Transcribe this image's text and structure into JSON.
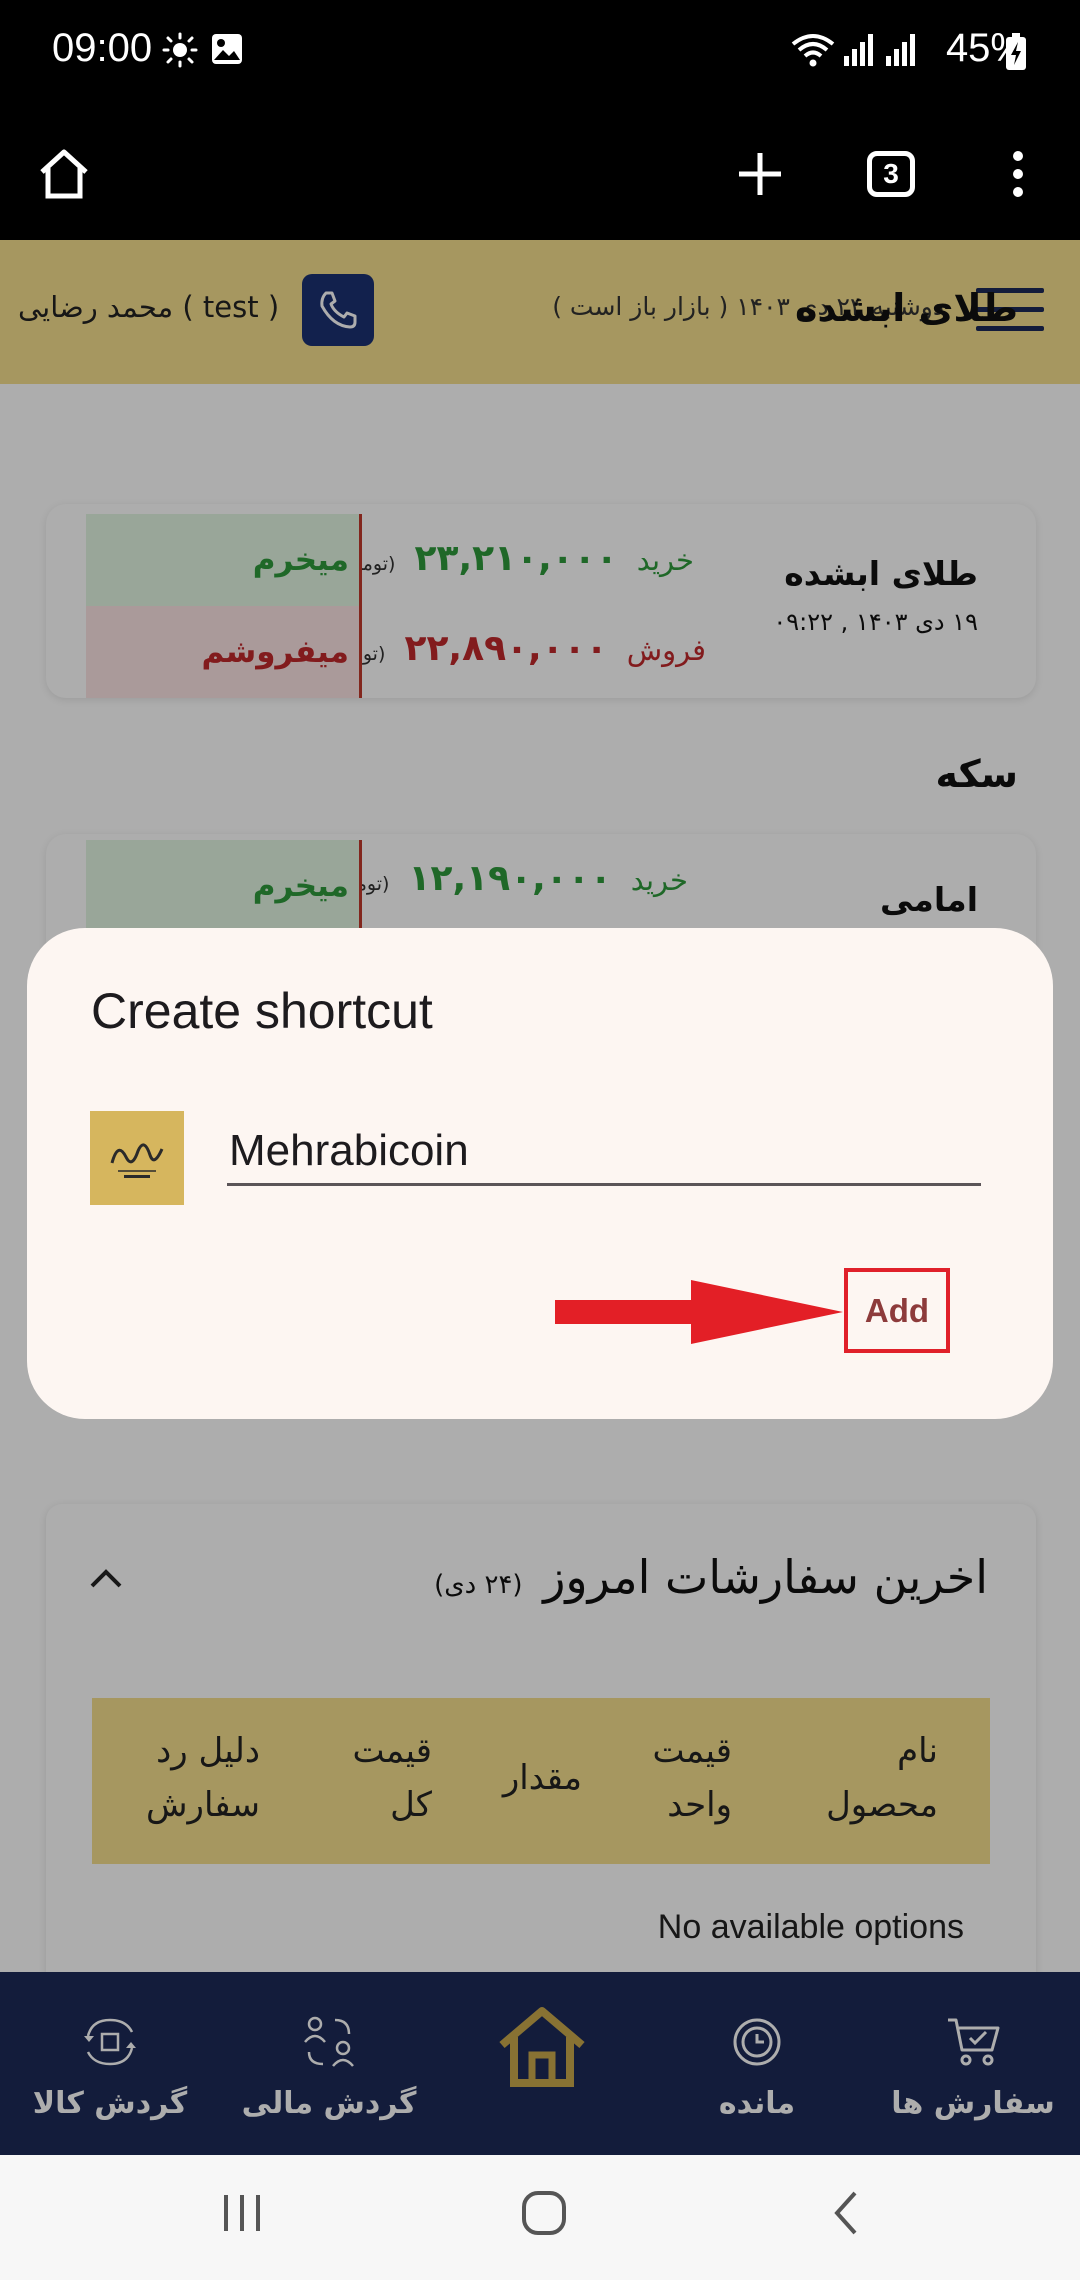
{
  "status_bar": {
    "time": "09:00",
    "battery": "45%",
    "icons": [
      "brightness-icon",
      "image-icon",
      "wifi-icon",
      "signal-icon",
      "signal-icon",
      "battery-charging-icon"
    ]
  },
  "browser": {
    "tab_count": "3",
    "icons": [
      "home-icon",
      "plus-icon",
      "tabs-icon",
      "more-vert-icon"
    ]
  },
  "site_header": {
    "date_text": "دوشنبه ۲۴ دی ۱۴۰۳ ( بازار باز است )",
    "user_text": "محمد رضایی ( test )"
  },
  "sections": {
    "abshode": {
      "title": "طلای ابشده",
      "card_name": "طلای ابشده",
      "card_date": "۱۹ دی ۱۴۰۳ , ۰۹:۲۲",
      "buy_label": "خرید",
      "buy_price": "۲۳,۲۱۰,۰۰۰",
      "sell_label": "فروش",
      "sell_price": "۲۲,۸۹۰,۰۰۰",
      "unit": "(تومان)",
      "buy_action": "میخرم",
      "sell_action": "میفروشم"
    },
    "coin": {
      "title": "سکه",
      "card_name": "امامی",
      "buy_label": "خرید",
      "buy_price": "۱۲,۱۹۰,۰۰۰",
      "unit": "(تومان)",
      "buy_action": "میخرم"
    }
  },
  "orders": {
    "title": "اخرین سفارشات امروز",
    "title_date": "(۲۴ دی)",
    "headers": [
      "نام محصول",
      "قیمت واحد",
      "مقدار",
      "قیمت کل",
      "دلیل رد سفارش"
    ],
    "empty_text": "No available options"
  },
  "bottom_nav": {
    "items": [
      {
        "label": "سفارش ها",
        "icon": "cart-icon"
      },
      {
        "label": "مانده",
        "icon": "clock-icon"
      },
      {
        "label": "",
        "icon": "home-icon"
      },
      {
        "label": "گردش مالی",
        "icon": "users-exchange-icon"
      },
      {
        "label": "گردش کالا",
        "icon": "box-exchange-icon"
      }
    ]
  },
  "dialog": {
    "title": "Create shortcut",
    "name_value": "Mehrabicoin",
    "add_label": "Add",
    "icon": "app-logo-icon",
    "annotation_color": "#e0202a"
  },
  "system_nav": {
    "icons": [
      "recents-icon",
      "home-circle-icon",
      "back-icon"
    ]
  }
}
